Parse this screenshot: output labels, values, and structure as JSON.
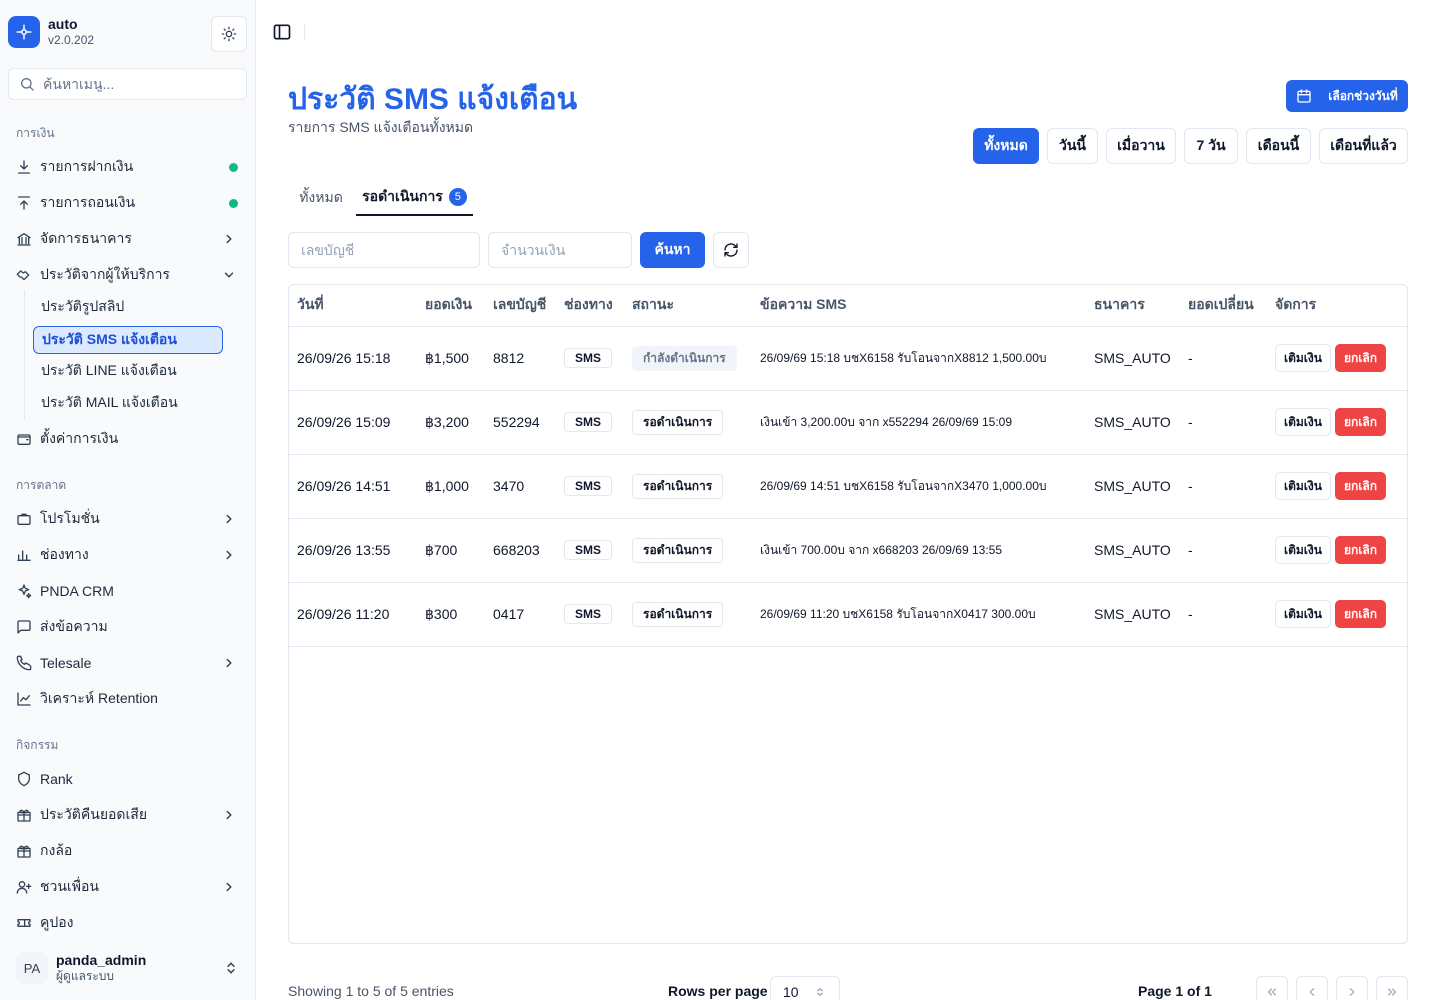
{
  "brand": {
    "name": "auto",
    "version": "v2.0.202"
  },
  "sidebar": {
    "search_placeholder": "ค้นหาเมนู...",
    "groups": {
      "finance": "การเงิน",
      "marketing": "การตลาด",
      "activity": "กิจกรรม"
    },
    "items": {
      "deposit": "รายการฝากเงิน",
      "withdraw": "รายการถอนเงิน",
      "bank": "จัดการธนาคาร",
      "provider_history": "ประวัติจากผู้ให้บริการ",
      "slip_history": "ประวัติรูปสลิป",
      "sms_history": "ประวัติ SMS แจ้งเตือน",
      "line_history": "ประวัติ LINE แจ้งเตือน",
      "mail_history": "ประวัติ MAIL แจ้งเตือน",
      "finance_settings": "ตั้งค่าการเงิน",
      "promotion": "โปรโมชั่น",
      "channel": "ช่องทาง",
      "crm": "PNDA CRM",
      "send_message": "ส่งข้อความ",
      "telesale": "Telesale",
      "retention": "วิเคราะห์ Retention",
      "rank": "Rank",
      "cashback": "ประวัติคืนยอดเสีย",
      "wheel": "กงล้อ",
      "invite": "ชวนเพื่อน",
      "coupon": "คูปอง"
    },
    "user": {
      "initials": "PA",
      "name": "panda_admin",
      "role": "ผู้ดูแลระบบ"
    }
  },
  "header": {
    "title": "ประวัติ SMS แจ้งเตือน",
    "subtitle": "รายการ SMS แจ้งเตือนทั้งหมด",
    "date_button": "เลือกช่วงวันที่",
    "ranges": [
      "ทั้งหมด",
      "วันนี้",
      "เมื่อวาน",
      "7 วัน",
      "เดือนนี้",
      "เดือนที่แล้ว"
    ],
    "active_range": "ทั้งหมด"
  },
  "tabs": {
    "all": "ทั้งหมด",
    "pending": "รอดำเนินการ",
    "pending_count": "5"
  },
  "filters": {
    "account_placeholder": "เลขบัญชี",
    "amount_placeholder": "จำนวนเงิน",
    "search_button": "ค้นหา"
  },
  "table": {
    "columns": [
      "วันที่",
      "ยอดเงิน",
      "เลขบัญชี",
      "ช่องทาง",
      "สถานะ",
      "ข้อความ SMS",
      "ธนาคาร",
      "ยอดเปลี่ยน",
      "จัดการ"
    ],
    "rows": [
      {
        "date": "26/09/26 15:18",
        "amount": "฿1,500",
        "account": "8812",
        "channel": "SMS",
        "status": "กำลังดำเนินการ",
        "status_type": "processing",
        "sms": "26/09/69 15:18 บชX6158 รับโอนจากX8812 1,500.00บ",
        "bank": "SMS_AUTO",
        "change": "-"
      },
      {
        "date": "26/09/26 15:09",
        "amount": "฿3,200",
        "account": "552294",
        "channel": "SMS",
        "status": "รอดำเนินการ",
        "status_type": "pending",
        "sms": "เงินเข้า 3,200.00บ จาก x552294 26/09/69 15:09",
        "bank": "SMS_AUTO",
        "change": "-"
      },
      {
        "date": "26/09/26 14:51",
        "amount": "฿1,000",
        "account": "3470",
        "channel": "SMS",
        "status": "รอดำเนินการ",
        "status_type": "pending",
        "sms": "26/09/69 14:51 บชX6158 รับโอนจากX3470 1,000.00บ",
        "bank": "SMS_AUTO",
        "change": "-"
      },
      {
        "date": "26/09/26 13:55",
        "amount": "฿700",
        "account": "668203",
        "channel": "SMS",
        "status": "รอดำเนินการ",
        "status_type": "pending",
        "sms": "เงินเข้า 700.00บ จาก x668203 26/09/69 13:55",
        "bank": "SMS_AUTO",
        "change": "-"
      },
      {
        "date": "26/09/26 11:20",
        "amount": "฿300",
        "account": "0417",
        "channel": "SMS",
        "status": "รอดำเนินการ",
        "status_type": "pending",
        "sms": "26/09/69 11:20 บชX6158 รับโอนจากX0417 300.00บ",
        "bank": "SMS_AUTO",
        "change": "-"
      }
    ],
    "action_topup": "เติมเงิน",
    "action_cancel": "ยกเลิก"
  },
  "footer": {
    "info": "Showing 1 to 5 of 5 entries",
    "rows_label": "Rows per page",
    "rows_value": "10",
    "page_label": "Page 1 of 1"
  },
  "colors": {
    "primary": "#2563eb",
    "danger": "#ef4444",
    "online": "#10b981"
  }
}
